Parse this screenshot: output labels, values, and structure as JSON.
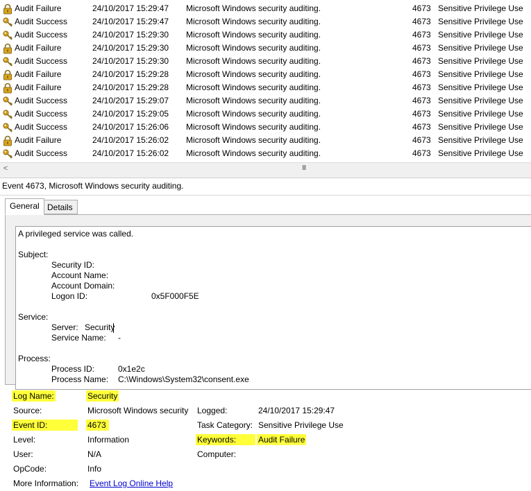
{
  "events": [
    {
      "level": "Audit Failure",
      "icon": "lock-icon",
      "datetime": "24/10/2017 15:29:47",
      "source": "Microsoft Windows security auditing.",
      "event_id": "4673",
      "category": "Sensitive Privilege Use"
    },
    {
      "level": "Audit Success",
      "icon": "key-icon",
      "datetime": "24/10/2017 15:29:47",
      "source": "Microsoft Windows security auditing.",
      "event_id": "4673",
      "category": "Sensitive Privilege Use"
    },
    {
      "level": "Audit Success",
      "icon": "key-icon",
      "datetime": "24/10/2017 15:29:30",
      "source": "Microsoft Windows security auditing.",
      "event_id": "4673",
      "category": "Sensitive Privilege Use"
    },
    {
      "level": "Audit Failure",
      "icon": "lock-icon",
      "datetime": "24/10/2017 15:29:30",
      "source": "Microsoft Windows security auditing.",
      "event_id": "4673",
      "category": "Sensitive Privilege Use"
    },
    {
      "level": "Audit Success",
      "icon": "key-icon",
      "datetime": "24/10/2017 15:29:30",
      "source": "Microsoft Windows security auditing.",
      "event_id": "4673",
      "category": "Sensitive Privilege Use"
    },
    {
      "level": "Audit Failure",
      "icon": "lock-icon",
      "datetime": "24/10/2017 15:29:28",
      "source": "Microsoft Windows security auditing.",
      "event_id": "4673",
      "category": "Sensitive Privilege Use"
    },
    {
      "level": "Audit Failure",
      "icon": "lock-icon",
      "datetime": "24/10/2017 15:29:28",
      "source": "Microsoft Windows security auditing.",
      "event_id": "4673",
      "category": "Sensitive Privilege Use"
    },
    {
      "level": "Audit Success",
      "icon": "key-icon",
      "datetime": "24/10/2017 15:29:07",
      "source": "Microsoft Windows security auditing.",
      "event_id": "4673",
      "category": "Sensitive Privilege Use"
    },
    {
      "level": "Audit Success",
      "icon": "key-icon",
      "datetime": "24/10/2017 15:29:05",
      "source": "Microsoft Windows security auditing.",
      "event_id": "4673",
      "category": "Sensitive Privilege Use"
    },
    {
      "level": "Audit Success",
      "icon": "key-icon",
      "datetime": "24/10/2017 15:26:06",
      "source": "Microsoft Windows security auditing.",
      "event_id": "4673",
      "category": "Sensitive Privilege Use"
    },
    {
      "level": "Audit Failure",
      "icon": "lock-icon",
      "datetime": "24/10/2017 15:26:02",
      "source": "Microsoft Windows security auditing.",
      "event_id": "4673",
      "category": "Sensitive Privilege Use"
    },
    {
      "level": "Audit Success",
      "icon": "key-icon",
      "datetime": "24/10/2017 15:26:02",
      "source": "Microsoft Windows security auditing.",
      "event_id": "4673",
      "category": "Sensitive Privilege Use"
    }
  ],
  "scrollbar": {
    "left_arrow": "<",
    "grip": "III"
  },
  "detail": {
    "title": "Event 4673, Microsoft Windows security auditing.",
    "tabs": {
      "general": "General",
      "details": "Details"
    },
    "description": {
      "intro": "A privileged service was called.",
      "subject_header": "Subject:",
      "security_id_label": "Security ID:",
      "account_name_label": "Account Name:",
      "account_domain_label": "Account Domain:",
      "logon_id_label": "Logon ID:",
      "logon_id_value": "0x5F000F5E",
      "service_header": "Service:",
      "server_label": "Server:",
      "server_value": "Security",
      "service_name_label": "Service Name:",
      "service_name_value": "-",
      "process_header": "Process:",
      "process_id_label": "Process ID:",
      "process_id_value": "0x1e2c",
      "process_name_label": "Process Name:",
      "process_name_value": "C:\\Windows\\System32\\consent.exe"
    },
    "properties": {
      "log_name_label": "Log Name:",
      "log_name_value": "Security",
      "source_label": "Source:",
      "source_value": "Microsoft Windows security",
      "logged_label": "Logged:",
      "logged_value": "24/10/2017 15:29:47",
      "event_id_label": "Event ID:",
      "event_id_value": "4673",
      "task_category_label": "Task Category:",
      "task_category_value": "Sensitive Privilege Use",
      "level_label": "Level:",
      "level_value": "Information",
      "keywords_label": "Keywords:",
      "keywords_value": "Audit Failure",
      "user_label": "User:",
      "user_value": "N/A",
      "computer_label": "Computer:",
      "opcode_label": "OpCode:",
      "opcode_value": "Info",
      "more_info_label": "More Information:",
      "more_info_link": "Event Log Online Help"
    }
  },
  "colors": {
    "highlight": "#ffff3a",
    "link": "#0000cc",
    "lock_gold": "#d9a520",
    "key_gold": "#d4a017"
  }
}
